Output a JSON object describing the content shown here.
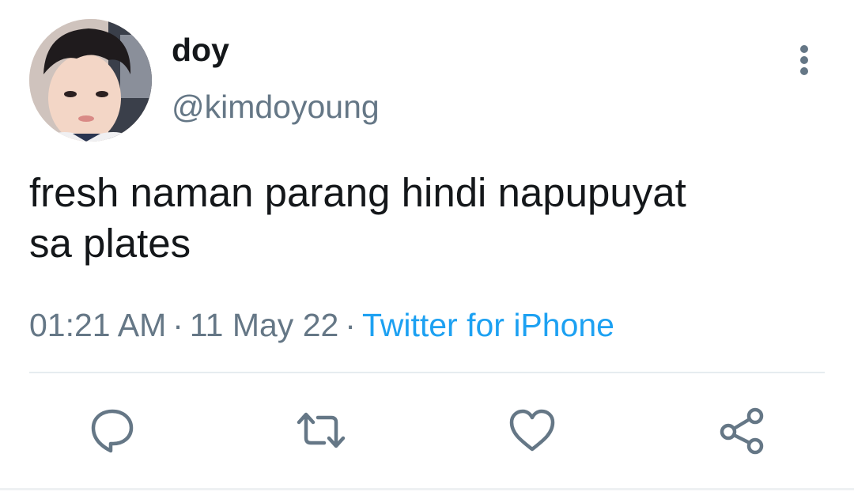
{
  "user": {
    "display_name": "doy",
    "handle": "@kimdoyoung",
    "avatar_icon": "profile-photo"
  },
  "tweet": {
    "text": "fresh naman parang hindi napupuyat\nsa plates",
    "time": "01:21 AM",
    "date": "11 May 22",
    "separator": "·",
    "source": "Twitter for iPhone"
  },
  "actions": {
    "reply_icon": "reply-icon",
    "retweet_icon": "retweet-icon",
    "like_icon": "heart-icon",
    "share_icon": "share-icon",
    "more_icon": "more-vertical-icon"
  },
  "colors": {
    "text": "#14171a",
    "secondary": "#657786",
    "link": "#1da1f2",
    "icon": "#657786",
    "divider": "#e6ecf0"
  }
}
